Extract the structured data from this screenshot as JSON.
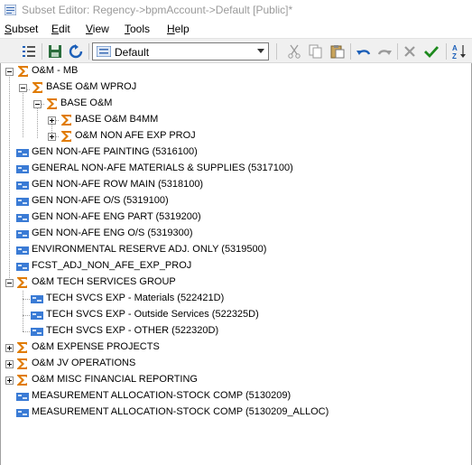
{
  "window": {
    "title": "Subset Editor:  Regency->bpmAccount->Default  [Public]*",
    "app_icon": "subset-editor-icon"
  },
  "menu": [
    {
      "label": "Subset",
      "accel": "S"
    },
    {
      "label": "Edit",
      "accel": "E"
    },
    {
      "label": "View",
      "accel": "V"
    },
    {
      "label": "Tools",
      "accel": "T"
    },
    {
      "label": "Help",
      "accel": "H"
    }
  ],
  "toolbar": {
    "subset_selector_value": "Default",
    "icons": [
      "subset-list-icon",
      "save-icon",
      "refresh-icon",
      "cut-icon",
      "copy-icon",
      "paste-icon",
      "undo-icon",
      "redo-icon",
      "delete-icon",
      "keep-icon",
      "sort-az-icon"
    ]
  },
  "colors": {
    "sigma": "#e07b00",
    "element_icon": "#3a7bd5",
    "accent_green": "#1e8a1e",
    "accent_blue": "#1c5fb8"
  },
  "tree": [
    {
      "label": "O&M - MB",
      "type": "consolidated",
      "expander": "minus"
    },
    {
      "label": "BASE O&M WPROJ",
      "type": "consolidated",
      "expander": "minus"
    },
    {
      "label": "BASE O&M",
      "type": "consolidated",
      "expander": "minus"
    },
    {
      "label": "BASE O&M B4MM",
      "type": "consolidated",
      "expander": "plus"
    },
    {
      "label": "O&M NON AFE EXP PROJ",
      "type": "consolidated",
      "expander": "plus"
    },
    {
      "label": "GEN NON-AFE PAINTING (5316100)",
      "type": "element"
    },
    {
      "label": "GENERAL NON-AFE MATERIALS & SUPPLIES (5317100)",
      "type": "element"
    },
    {
      "label": "GEN NON-AFE ROW MAIN (5318100)",
      "type": "element"
    },
    {
      "label": "GEN NON-AFE O/S (5319100)",
      "type": "element"
    },
    {
      "label": "GEN NON-AFE ENG PART (5319200)",
      "type": "element"
    },
    {
      "label": "GEN NON-AFE ENG O/S (5319300)",
      "type": "element"
    },
    {
      "label": "ENVIRONMENTAL RESERVE ADJ. ONLY (5319500)",
      "type": "element"
    },
    {
      "label": "FCST_ADJ_NON_AFE_EXP_PROJ",
      "type": "element"
    },
    {
      "label": "O&M TECH SERVICES GROUP",
      "type": "consolidated",
      "expander": "minus"
    },
    {
      "label": "TECH SVCS EXP - Materials (522421D)",
      "type": "element"
    },
    {
      "label": "TECH SVCS EXP - Outside Services (522325D)",
      "type": "element"
    },
    {
      "label": "TECH SVCS EXP - OTHER (522320D)",
      "type": "element"
    },
    {
      "label": "O&M EXPENSE PROJECTS",
      "type": "consolidated",
      "expander": "plus"
    },
    {
      "label": "O&M JV OPERATIONS",
      "type": "consolidated",
      "expander": "plus"
    },
    {
      "label": "O&M MISC FINANCIAL REPORTING",
      "type": "consolidated",
      "expander": "plus"
    },
    {
      "label": "MEASUREMENT ALLOCATION-STOCK COMP (5130209)",
      "type": "element"
    },
    {
      "label": "MEASUREMENT ALLOCATION-STOCK COMP (5130209_ALLOC)",
      "type": "element"
    }
  ]
}
